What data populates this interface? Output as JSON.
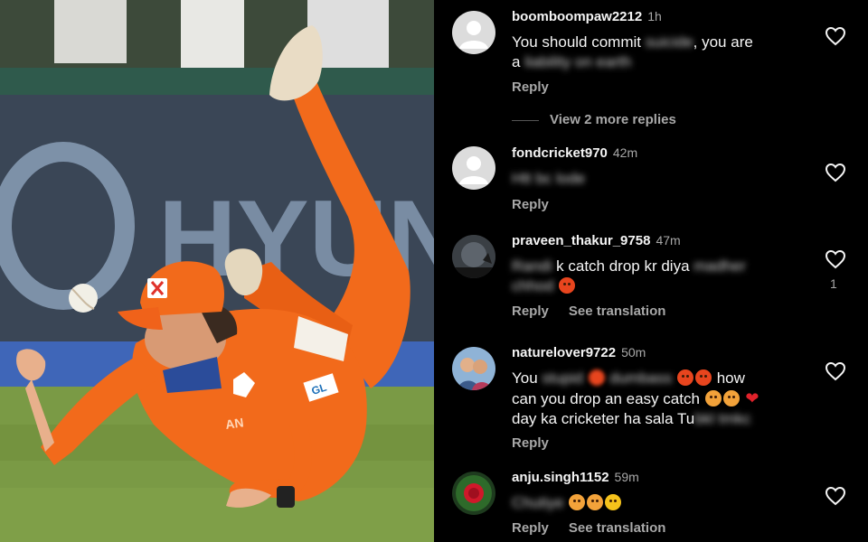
{
  "photo": {
    "alt": "Cricketer in orange kit diving to drop a catch",
    "board_text": "HYUN",
    "shirt_badge": "GL",
    "shirt_text": "AN"
  },
  "comments": [
    {
      "username": "boomboompaw2212",
      "time": "1h",
      "avatar": "default-avatar",
      "text_plain_1": "You should commit ",
      "text_blur_1": "suicide",
      "text_plain_2": ", you are",
      "text_plain_3": "a ",
      "text_blur_2": "liability on earth",
      "reply_label": "Reply",
      "more_replies": "View 2 more replies"
    },
    {
      "username": "fondcricket970",
      "time": "42m",
      "avatar": "default-avatar",
      "text_blur_1": "Htt bc lode",
      "reply_label": "Reply"
    },
    {
      "username": "praveen_thakur_9758",
      "time": "47m",
      "avatar": "dark-photo-avatar",
      "text_blur_1": "Randi",
      "text_plain_1": " k catch drop kr diya ",
      "text_blur_2": "madher",
      "text_blur_3": "chhod",
      "reply_label": "Reply",
      "translate_label": "See translation",
      "likes": "1"
    },
    {
      "username": "naturelover9722",
      "time": "50m",
      "avatar": "couple-photo-avatar",
      "text_plain_1": "You ",
      "text_blur_1": "stupid",
      "text_blur_2": "dumbass",
      "text_plain_2": " how",
      "text_plain_3": "can you drop an easy catch ",
      "text_plain_4": "day ka cricketer ha sala Tu",
      "text_blur_3": "bkl tmkc",
      "reply_label": "Reply"
    },
    {
      "username": "anju.singh1152",
      "time": "59m",
      "avatar": "rose-avatar",
      "text_blur_1": "Chutiye",
      "reply_label": "Reply",
      "translate_label": "See translation"
    }
  ],
  "colors": {
    "background": "#000000",
    "text": "#f5f5f5",
    "secondary_text": "#a8a8a8",
    "jersey_orange": "#f26a1b"
  }
}
